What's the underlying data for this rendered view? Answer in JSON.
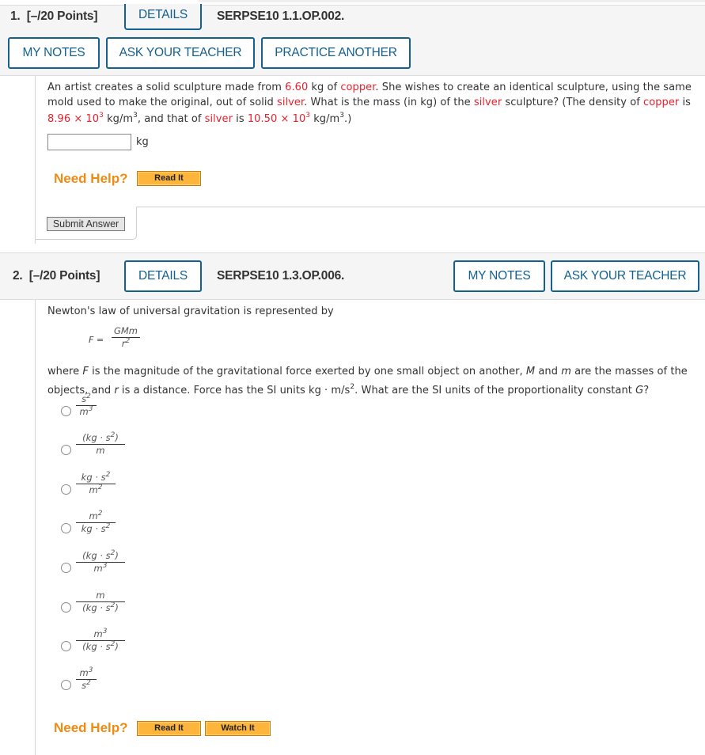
{
  "questions": [
    {
      "number": "1.",
      "points": "[–/20 Points]",
      "details_label": "DETAILS",
      "code": "SERPSE10 1.1.OP.002.",
      "actions": [
        "MY NOTES",
        "ASK YOUR TEACHER",
        "PRACTICE ANOTHER"
      ],
      "prompt": {
        "line1_a": "An artist creates a solid sculpture made from ",
        "mass_value": "6.60",
        "line1_b": " kg of ",
        "copper_1": "copper",
        "line1_c": ". She wishes to create an identical sculpture, using the same",
        "line2_a": "mold used to make the original, out of solid ",
        "silver_1": "silver",
        "line2_b": ". What is the mass (in kg) of the ",
        "silver_2": "silver",
        "line2_c": " sculpture? (The density of ",
        "copper_2": "copper",
        "line2_d": " is",
        "copper_density": "8.96 × 10",
        "exp_3": "3",
        "unit_kg_m": " kg/m",
        "line3_b": ", and that of ",
        "silver_3": "silver",
        "line3_c": " is ",
        "silver_density": "10.50 × 10",
        "line3_end": ".)"
      },
      "answer": {
        "value": "",
        "unit": "kg"
      },
      "need_help": "Need Help?",
      "help_buttons": [
        "Read It"
      ],
      "submit_label": "Submit Answer"
    },
    {
      "number": "2.",
      "points": "[–/20 Points]",
      "details_label": "DETAILS",
      "code": "SERPSE10 1.3.OP.006.",
      "actions": [
        "MY NOTES",
        "ASK YOUR TEACHER"
      ],
      "intro": "Newton's law of universal gravitation is represented by",
      "formula": {
        "lhs": "F =",
        "numerator": "GMm",
        "denominator": "r",
        "den_exp": "2"
      },
      "desc": {
        "l1_a": "where ",
        "F": "F",
        "l1_b": " is the magnitude of the gravitational force exerted by one small object on another, ",
        "M": "M",
        "l1_c": " and ",
        "m": "m",
        "l1_d": " are the masses of the",
        "l2_a": "objects, and ",
        "r": "r",
        "l2_b": " is a distance. Force has the SI units kg · m/s",
        "exp2": "2",
        "l2_c": ". What are the SI units of the proportionality constant ",
        "G": "G",
        "l2_d": "?"
      },
      "options": [
        {
          "num": "s",
          "num_exp": "2",
          "den": "m",
          "den_exp": "3",
          "num_close": "",
          "den_close": ""
        },
        {
          "num": "(kg · s",
          "num_exp": "2",
          "num_close": ")",
          "den": "m",
          "den_exp": "",
          "den_close": ""
        },
        {
          "num": "kg · s",
          "num_exp": "2",
          "num_close": "",
          "den": "m",
          "den_exp": "2",
          "den_close": ""
        },
        {
          "num": "m",
          "num_exp": "2",
          "num_close": "",
          "den": "kg · s",
          "den_exp": "2",
          "den_close": ""
        },
        {
          "num": "(kg · s",
          "num_exp": "2",
          "num_close": ")",
          "den": "m",
          "den_exp": "3",
          "den_close": ""
        },
        {
          "num": "m",
          "num_exp": "",
          "num_close": "",
          "den": "(kg · s",
          "den_exp": "2",
          "den_close": ")"
        },
        {
          "num": "m",
          "num_exp": "3",
          "num_close": "",
          "den": "(kg · s",
          "den_exp": "2",
          "den_close": ")"
        },
        {
          "num": "m",
          "num_exp": "3",
          "num_close": "",
          "den": "s",
          "den_exp": "2",
          "den_close": ""
        }
      ],
      "need_help": "Need Help?",
      "help_buttons": [
        "Read It",
        "Watch It"
      ]
    }
  ],
  "colors": {
    "accent": "#14608f",
    "highlight_red": "#e8212d",
    "help_orange": "#ef8a12",
    "help_button": "#fdb53c"
  }
}
